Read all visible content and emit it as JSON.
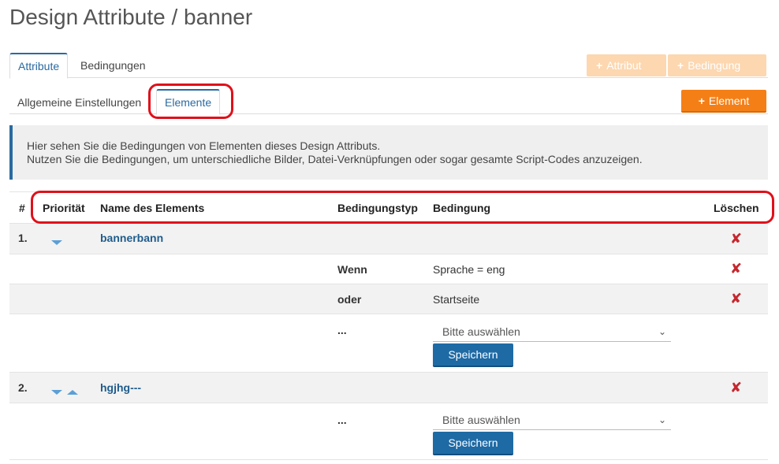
{
  "page": {
    "title": "Design Attribute / banner"
  },
  "main_tabs": [
    {
      "label": "Attribute",
      "active": true
    },
    {
      "label": "Bedingungen",
      "active": false
    }
  ],
  "toolbar": {
    "add_attribut_label": "Attribut",
    "add_bedingung_label": "Bedingung",
    "add_element_label": "Element",
    "plus_glyph": "+"
  },
  "sub_tabs": [
    {
      "label": "Allgemeine Einstellungen",
      "active": false
    },
    {
      "label": "Elemente",
      "active": true
    }
  ],
  "info": {
    "line1": "Hier sehen Sie die Bedingungen von Elementen dieses Design Attributs.",
    "line2": "Nutzen Sie die Bedingungen, um unterschiedliche Bilder, Datei-Verknüpfungen oder sogar gesamte Script-Codes anzuzeigen."
  },
  "table": {
    "columns": {
      "num": "#",
      "priority": "Priorität",
      "name": "Name des Elements",
      "ctype": "Bedingungstyp",
      "condition": "Bedingung",
      "delete": "Löschen"
    },
    "elements": [
      {
        "index": "1.",
        "name": "bannerbann",
        "conditions": [
          {
            "type": "Wenn",
            "value": "Sprache = eng"
          },
          {
            "type": "oder",
            "value": "Startseite"
          }
        ],
        "new_row": {
          "type": "...",
          "select_placeholder": "Bitte auswählen",
          "save_label": "Speichern"
        }
      },
      {
        "index": "2.",
        "name": "hgjhg---",
        "conditions": [],
        "new_row": {
          "type": "...",
          "select_placeholder": "Bitte auswählen",
          "save_label": "Speichern"
        }
      }
    ]
  },
  "delete_glyph": "✘",
  "chevron_glyph": "⌄",
  "colors": {
    "accent": "#2a6aa0",
    "orange": "#f57f17",
    "disabled_orange": "#fcd7b0",
    "highlight": "#e0101a",
    "delete": "#c5272e"
  }
}
